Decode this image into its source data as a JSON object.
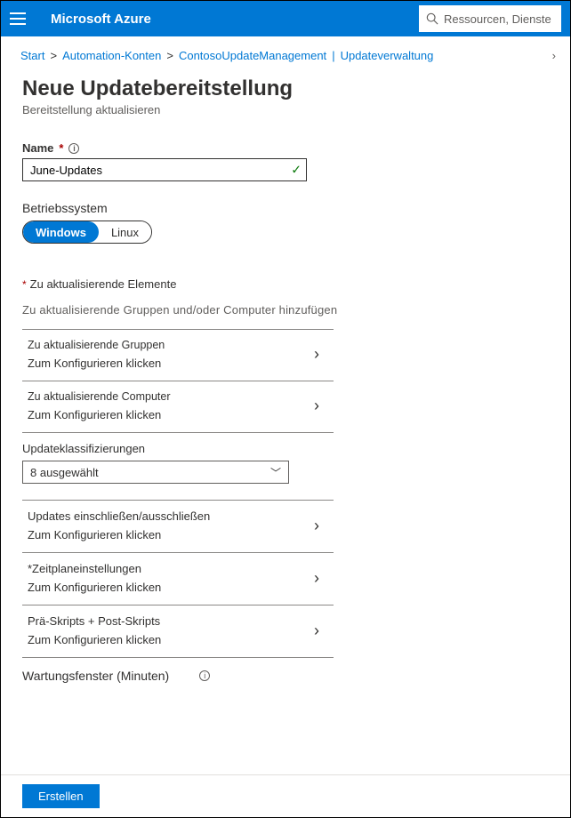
{
  "header": {
    "brand": "Microsoft Azure",
    "search_placeholder": "Ressourcen, Dienste"
  },
  "breadcrumb": {
    "items": [
      "Start",
      "Automation-Konten",
      "ContosoUpdateManagement",
      "Updateverwaltung"
    ]
  },
  "page": {
    "title": "Neue Updatebereitstellung",
    "subtitle": "Bereitstellung aktualisieren"
  },
  "form": {
    "name_label": "Name",
    "name_value": "June-Updates",
    "os_label": "Betriebssystem",
    "os_options": {
      "windows": "Windows",
      "linux": "Linux"
    },
    "items_heading": "Zu aktualisierende Elemente",
    "items_sub": "Zu aktualisierende Gruppen und/oder Computer hinzufügen",
    "configure_hint": "Zum Konfigurieren klicken",
    "groups_title": "Zu aktualisierende Gruppen",
    "computers_title": "Zu aktualisierende Computer",
    "classifications_label": "Updateklassifizierungen",
    "classifications_value": "8 ausgewählt",
    "include_exclude_title": "Updates einschließen/ausschließen",
    "schedule_title": "*Zeitplaneinstellungen",
    "scripts_title": "Prä-Skripts +   Post-Skripts",
    "maintenance_label": "Wartungsfenster (Minuten)"
  },
  "footer": {
    "create_label": "Erstellen"
  }
}
